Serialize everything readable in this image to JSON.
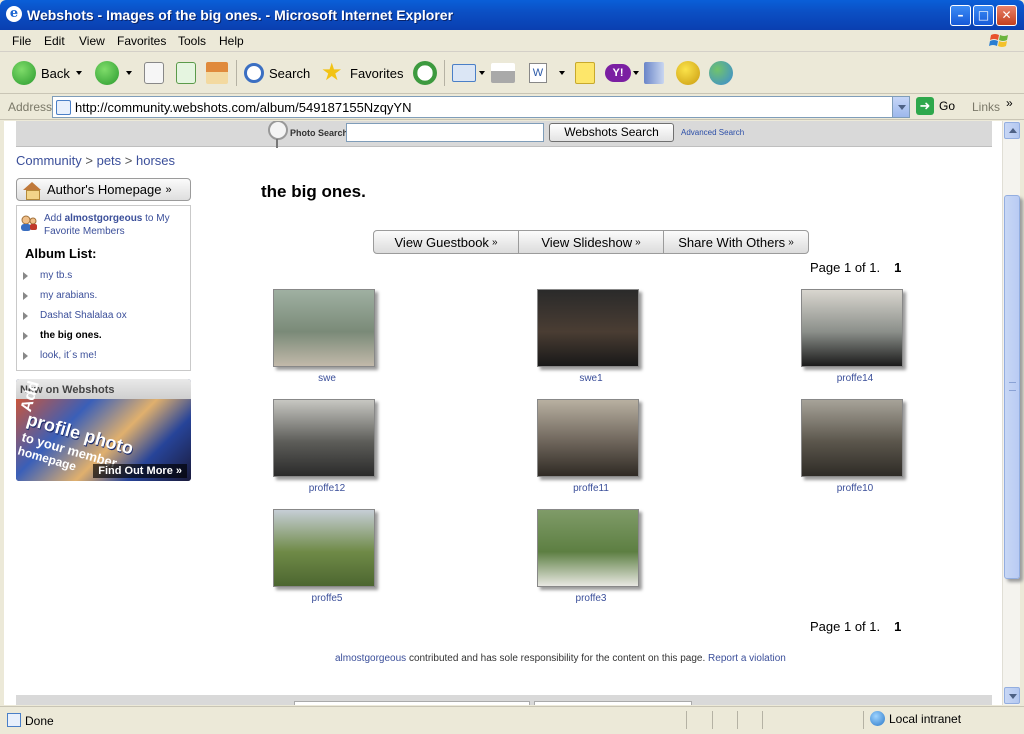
{
  "window": {
    "title": "Webshots - Images of the big ones. - Microsoft Internet Explorer",
    "minimize": "–",
    "maximize": "□",
    "close": "✕"
  },
  "menu": [
    "File",
    "Edit",
    "View",
    "Favorites",
    "Tools",
    "Help"
  ],
  "toolbar": {
    "back": "Back",
    "search": "Search",
    "favorites": "Favorites"
  },
  "address": {
    "label": "Address",
    "url": "http://community.webshots.com/album/549187155NzqyYN",
    "go": "Go",
    "links": "Links",
    "more": "»"
  },
  "search_strip": {
    "label": "Photo Search",
    "button": "Webshots Search",
    "advanced": "Advanced Search"
  },
  "breadcrumb": {
    "community": "Community",
    "sep": ">",
    "pets": "pets",
    "horses": "horses"
  },
  "sidebar": {
    "author_button": "Author's Homepage",
    "chevron": "»",
    "add_prefix": "Add",
    "add_user": "almostgorgeous",
    "add_suffix": "to My Favorite Members",
    "album_list_heading": "Album List:",
    "albums": [
      {
        "label": "my tb.s"
      },
      {
        "label": "my arabians."
      },
      {
        "label": "Dashat Shalalaa ox"
      },
      {
        "label": "the big ones."
      },
      {
        "label": "look, it´s me!"
      }
    ]
  },
  "promo": {
    "header": "New on Webshots",
    "add": "Add a",
    "line1": "profile photo",
    "line2": "to your member",
    "line3": "homepage",
    "cta": "Find Out More »"
  },
  "album": {
    "title": "the big ones.",
    "actions": [
      "View Guestbook",
      "View Slideshow",
      "Share With Others"
    ],
    "action_chevron": "»",
    "pager_text": "Page 1 of 1.",
    "pager_num": "1",
    "photos": [
      {
        "caption": "swe",
        "colors": [
          "#9fb0a2",
          "#7a8a78",
          "#c2b9aa"
        ]
      },
      {
        "caption": "swe1",
        "colors": [
          "#2a2a2a",
          "#4a3d33",
          "#181818"
        ]
      },
      {
        "caption": "proffe14",
        "colors": [
          "#d9d6cf",
          "#8b8f8a",
          "#1a1a1a"
        ]
      },
      {
        "caption": "proffe12",
        "colors": [
          "#c7c7c2",
          "#5d5d59",
          "#2a2a2a"
        ]
      },
      {
        "caption": "proffe11",
        "colors": [
          "#b8b0a1",
          "#6e655b",
          "#2f2a24"
        ]
      },
      {
        "caption": "proffe10",
        "colors": [
          "#a7a399",
          "#5b564c",
          "#2e2b26"
        ]
      },
      {
        "caption": "proffe5",
        "colors": [
          "#c6ced6",
          "#6f8a47",
          "#4c6630"
        ]
      },
      {
        "caption": "proffe3",
        "colors": [
          "#7f9b68",
          "#5d7f42",
          "#e8e8e2"
        ]
      }
    ]
  },
  "footer": {
    "user": "almostgorgeous",
    "text": "contributed and has sole responsibility for the content on this page.",
    "report": "Report a violation"
  },
  "status": {
    "text": "Done",
    "zone": "Local intranet"
  }
}
